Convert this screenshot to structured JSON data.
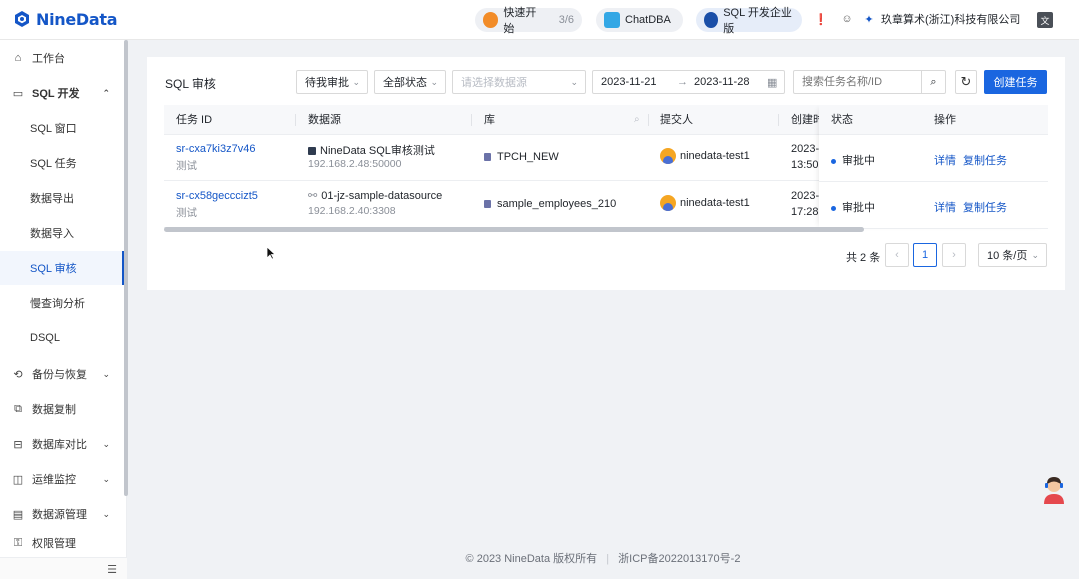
{
  "app": {
    "name": "NineData"
  },
  "topbar": {
    "quickstart": {
      "label": "快速开始",
      "progress": "3/6"
    },
    "chatdba": {
      "label": "ChatDBA"
    },
    "edition": {
      "label": "SQL 开发企业版"
    },
    "company": "玖章算术(浙江)科技有限公司",
    "icons": [
      "notification-icon",
      "help-icon",
      "org-icon",
      "language-icon"
    ]
  },
  "sidebar": {
    "items": [
      {
        "label": "工作台",
        "icon": "home-icon",
        "type": "item"
      },
      {
        "label": "SQL 开发",
        "icon": "monitor-icon",
        "type": "group",
        "expanded": true
      },
      {
        "label": "SQL 窗口",
        "type": "sub"
      },
      {
        "label": "SQL 任务",
        "type": "sub"
      },
      {
        "label": "数据导出",
        "type": "sub"
      },
      {
        "label": "数据导入",
        "type": "sub"
      },
      {
        "label": "SQL 审核",
        "type": "sub",
        "active": true
      },
      {
        "label": "慢查询分析",
        "type": "sub"
      },
      {
        "label": "DSQL",
        "type": "sub"
      },
      {
        "label": "备份与恢复",
        "icon": "backup-icon",
        "type": "item",
        "chevron": true
      },
      {
        "label": "数据复制",
        "icon": "replicate-icon",
        "type": "item"
      },
      {
        "label": "数据库对比",
        "icon": "compare-icon",
        "type": "item",
        "chevron": true
      },
      {
        "label": "运维监控",
        "icon": "monitor-ops-icon",
        "type": "item",
        "chevron": true
      },
      {
        "label": "数据源管理",
        "icon": "datasource-icon",
        "type": "item",
        "chevron": true
      },
      {
        "label": "权限管理",
        "icon": "permission-icon",
        "type": "item"
      }
    ]
  },
  "page": {
    "title": "SQL 审核",
    "filters": {
      "assignee": "待我审批",
      "status": "全部状态",
      "datasource_placeholder": "请选择数据源",
      "date_start": "2023-11-21",
      "date_end": "2023-11-28",
      "search_placeholder": "搜索任务名称/ID"
    },
    "create_button": "创建任务",
    "table": {
      "columns": [
        "任务 ID",
        "数据源",
        "库",
        "提交人",
        "创建时",
        "状态",
        "操作"
      ],
      "rows": [
        {
          "id": "sr-cxa7ki3z7v46",
          "note": "测试",
          "datasource": "NineData SQL审核测试",
          "address": "192.168.2.48:50000",
          "database": "TPCH_NEW",
          "submitter": "ninedata-test1",
          "created_date": "2023-",
          "created_time": "13:50:",
          "status": "审批中",
          "action_detail": "详情",
          "action_copy": "复制任务"
        },
        {
          "id": "sr-cx58gecccizt5",
          "note": "测试",
          "datasource": "01-jz-sample-datasource",
          "address": "192.168.2.40:3308",
          "database": "sample_employees_210",
          "submitter": "ninedata-test1",
          "created_date": "2023-",
          "created_time": "17:28:",
          "status": "审批中",
          "action_detail": "详情",
          "action_copy": "复制任务"
        }
      ]
    },
    "pagination": {
      "total": "共 2 条",
      "current": "1",
      "page_size": "10 条/页"
    }
  },
  "footer": {
    "copyright": "© 2023 NineData 版权所有",
    "icp": "浙ICP备2022013170号-2"
  },
  "colors": {
    "primary": "#1a66e0",
    "brand": "#1456c7"
  }
}
